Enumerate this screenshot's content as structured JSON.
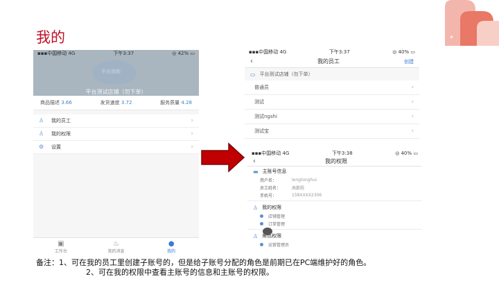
{
  "slide": {
    "title": "我的",
    "corner_mark": "*"
  },
  "phone_profile": {
    "status": {
      "carrier": "▪▪▪中国移动 4G",
      "time": "下午3:37",
      "battery": "◎ 42% ▭"
    },
    "logo_text": "平台旗舰",
    "store_name": "平台测试店铺（勿下单）",
    "ratings": [
      {
        "label": "商品描述",
        "value": "3.66"
      },
      {
        "label": "发货速度",
        "value": "3.72"
      },
      {
        "label": "服务质量",
        "value": "4.28"
      }
    ],
    "menu": [
      {
        "icon": "user-group-icon",
        "glyph": "♙",
        "label": "我的员工"
      },
      {
        "icon": "permission-icon",
        "glyph": "♙",
        "label": "我的权限"
      },
      {
        "icon": "gear-icon",
        "glyph": "⚙",
        "label": "设置"
      }
    ],
    "tabs": [
      {
        "icon": "workbench-icon",
        "glyph": "▣",
        "label": "工作台",
        "active": false
      },
      {
        "icon": "message-icon",
        "glyph": "♨",
        "label": "我的消息",
        "active": false
      },
      {
        "icon": "profile-icon",
        "glyph": "●",
        "label": "我的",
        "active": true
      }
    ]
  },
  "phone_staff": {
    "status": {
      "carrier": "▪▪▪中国移动 4G",
      "time": "下午3:37",
      "battery": "◎ 40% ▭"
    },
    "nav_title": "我的员工",
    "nav_action": "创建",
    "store_label": "平台测试店铺（勿下单）",
    "rows": [
      "普通员",
      "测试",
      "测试ngshi",
      "测试宝"
    ]
  },
  "phone_permissions": {
    "status": {
      "carrier": "▪▪▪中国移动 4G",
      "time": "下午3:38",
      "battery": "◎ 40% ▭"
    },
    "nav_title": "我的权限",
    "account_section": "主账号信息",
    "fields": [
      {
        "key": "用户名：",
        "value": "lengtonghui"
      },
      {
        "key": "员工姓名：",
        "value": "高鹏程"
      },
      {
        "key": "手机号：",
        "value": "158XXXX2306"
      }
    ],
    "perm_section": "我的权限",
    "perm_items": [
      "店铺管理",
      "订单管理"
    ],
    "role_section": "角色权限",
    "role_items": [
      "运营管理员"
    ]
  },
  "notes": [
    "备注：1、可在我的员工里创建子账号的，但是给子账号分配的角色是前期已在PC端维护好的角色。",
    "2、可在我的权限中查看主账号的信息和主账号的权限。"
  ],
  "colors": {
    "title": "#c0102a",
    "arrow": "#c00000",
    "accent": "#3a7bd5"
  }
}
